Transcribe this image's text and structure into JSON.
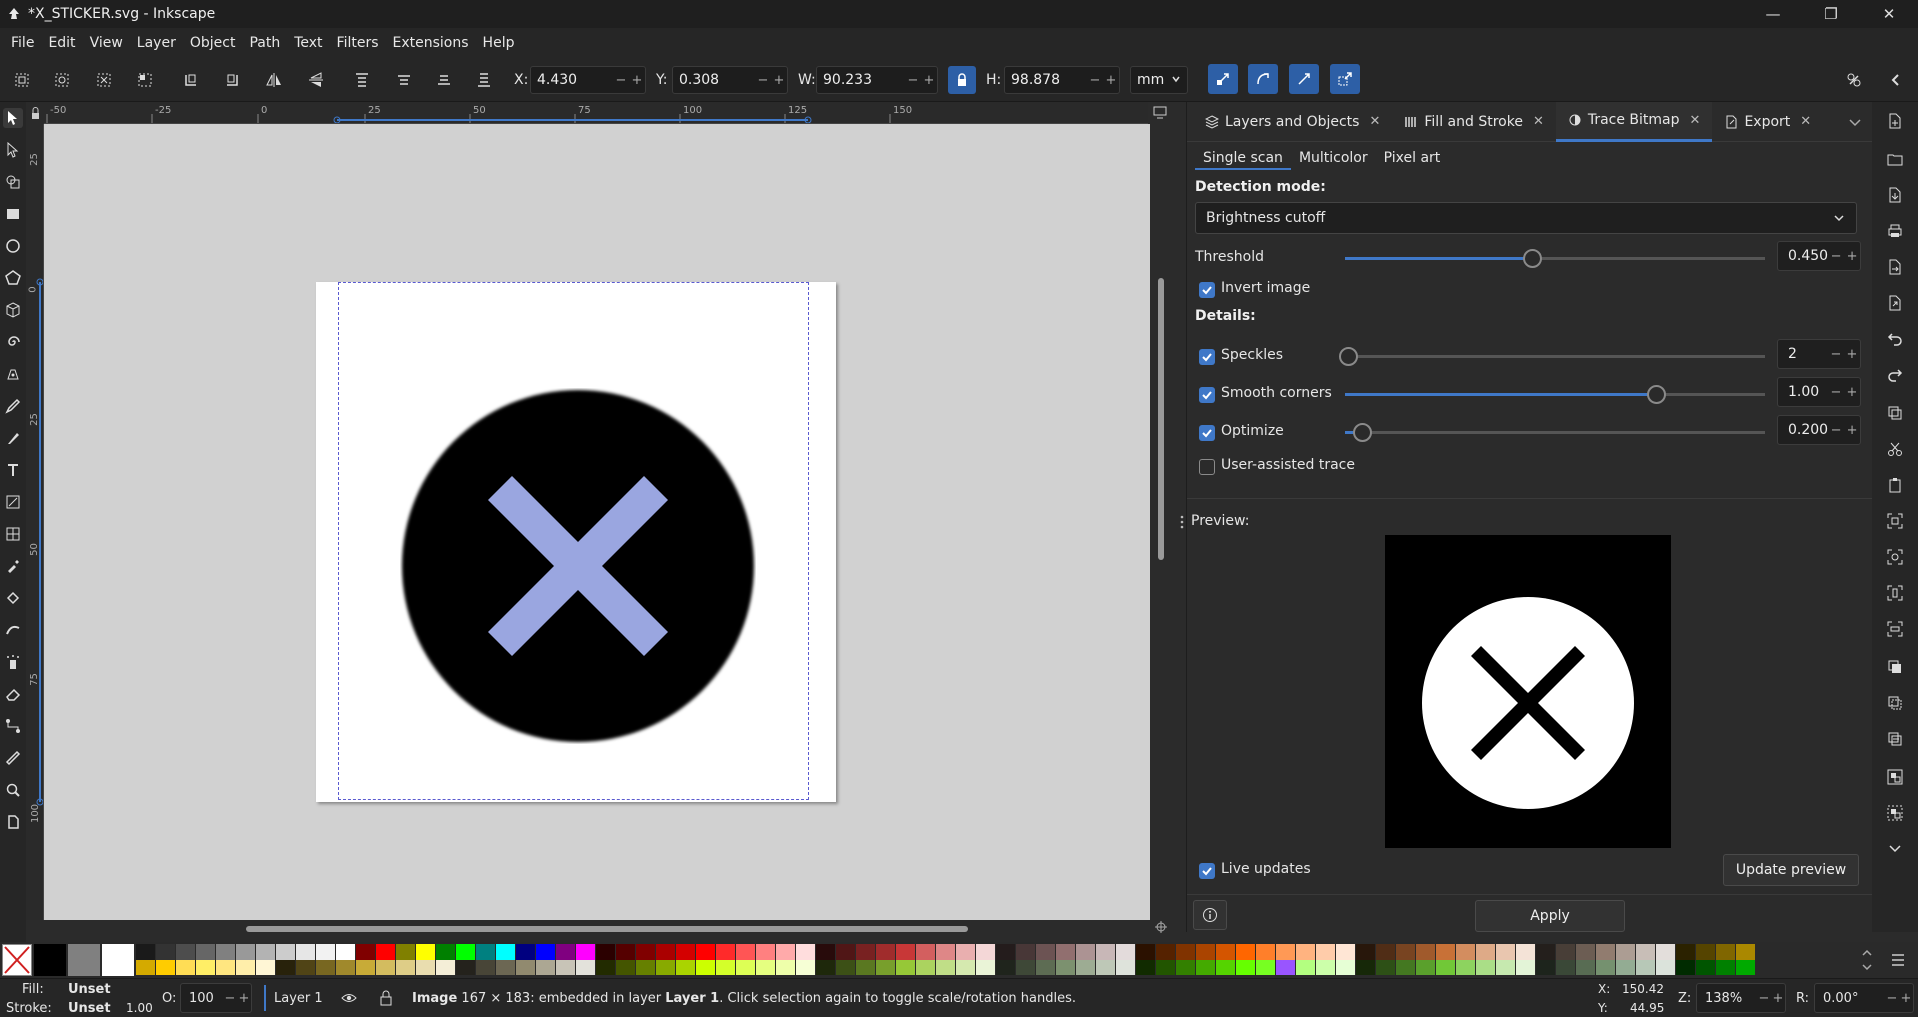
{
  "window": {
    "title": "*X_STICKER.svg - Inkscape"
  },
  "menu": [
    "File",
    "Edit",
    "View",
    "Layer",
    "Object",
    "Path",
    "Text",
    "Filters",
    "Extensions",
    "Help"
  ],
  "toolbar": {
    "x_label": "X:",
    "x_value": "4.430",
    "y_label": "Y:",
    "y_value": "0.308",
    "w_label": "W:",
    "w_value": "90.233",
    "h_label": "H:",
    "h_value": "98.878",
    "unit": "mm",
    "minus": "−",
    "plus": "+"
  },
  "ruler": {
    "h_ticks": [
      "-50",
      "-25",
      "0",
      "25",
      "50",
      "75",
      "100",
      "125",
      "150"
    ],
    "v_ticks": [
      "25",
      "0",
      "25",
      "50",
      "75",
      "100"
    ]
  },
  "canvas": {
    "sticker_circle_color": "#000000",
    "sticker_x_color": "#9aa6e0"
  },
  "dock": {
    "tabs": [
      {
        "label": "Layers and Objects",
        "icon": "layers-icon"
      },
      {
        "label": "Fill and Stroke",
        "icon": "fill-stroke-icon"
      },
      {
        "label": "Trace Bitmap",
        "icon": "trace-bitmap-icon"
      },
      {
        "label": "Export",
        "icon": "export-icon"
      }
    ],
    "subtabs": [
      "Single scan",
      "Multicolor",
      "Pixel art"
    ],
    "detection_mode_label": "Detection mode:",
    "detection_mode_value": "Brightness cutoff",
    "threshold_label": "Threshold",
    "threshold_value": "0.450",
    "invert_label": "Invert image",
    "details_label": "Details:",
    "speckles_label": "Speckles",
    "speckles_value": "2",
    "smooth_label": "Smooth corners",
    "smooth_value": "1.00",
    "optimize_label": "Optimize",
    "optimize_value": "0.200",
    "user_assisted_label": "User-assisted trace",
    "preview_label": "Preview:",
    "live_updates_label": "Live updates",
    "update_preview_label": "Update preview",
    "apply_label": "Apply",
    "close": "✕"
  },
  "status": {
    "fill_label": "Fill:",
    "fill_value": "Unset",
    "stroke_label": "Stroke:",
    "stroke_value": "Unset",
    "stroke_width": "1.00",
    "opacity_label": "O:",
    "opacity_value": "100",
    "layer": "Layer 1",
    "msg_image": "Image",
    "msg_mid": "167 × 183: embedded in layer",
    "msg_layer": "Layer 1",
    "msg_end": ". Click selection again to toggle scale/rotation handles.",
    "cursor_x_label": "X:",
    "cursor_x": "150.42",
    "cursor_y_label": "Y:",
    "cursor_y": "44.95",
    "zoom_label": "Z:",
    "zoom": "138%",
    "rotation_label": "R:",
    "rotation": "0.00°"
  }
}
